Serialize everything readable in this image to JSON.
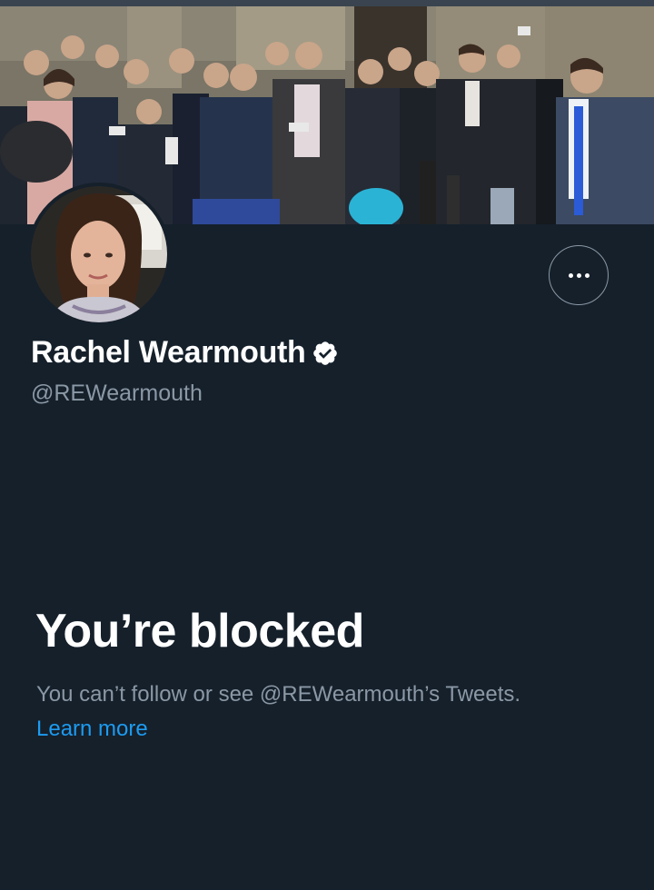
{
  "profile": {
    "display_name": "Rachel Wearmouth",
    "handle": "@REWearmouth",
    "verified": true,
    "banner_description": "crowd of journalists with microphones and phones around a man in a suit",
    "avatar_description": "portrait of a woman with brown hair"
  },
  "blocked": {
    "title": "You’re blocked",
    "description": "You can’t follow or see @REWearmouth’s Tweets.",
    "learn_more": "Learn more"
  },
  "icons": {
    "more": "more-horizontal-icon",
    "verified": "verified-badge-icon"
  },
  "colors": {
    "background": "#15202b",
    "primary_text": "#ffffff",
    "secondary_text": "#8b98a5",
    "link": "#1d9bf0"
  }
}
